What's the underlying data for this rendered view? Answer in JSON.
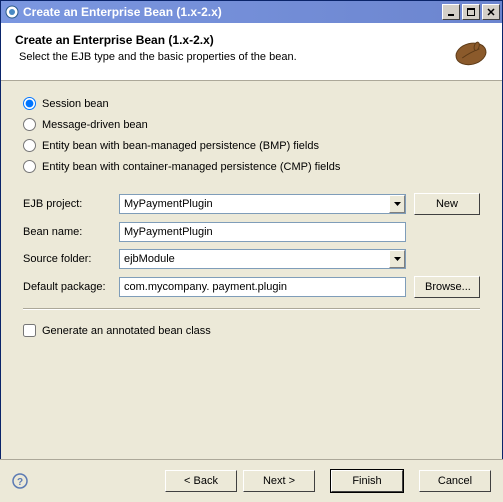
{
  "window": {
    "title": "Create an Enterprise Bean (1.x-2.x)"
  },
  "banner": {
    "title": "Create an Enterprise Bean (1.x-2.x)",
    "subtitle": "Select the EJB type and the basic properties of the bean."
  },
  "beanTypes": {
    "selected": "session",
    "session": "Session bean",
    "mdb": "Message-driven bean",
    "bmp": "Entity bean with bean-managed persistence (BMP) fields",
    "cmp": "Entity bean with container-managed persistence (CMP) fields"
  },
  "form": {
    "ejbProject": {
      "label": "EJB project:",
      "value": "MyPaymentPlugin",
      "newBtn": "New"
    },
    "beanName": {
      "label": "Bean name:",
      "value": "MyPaymentPlugin"
    },
    "sourceFolder": {
      "label": "Source folder:",
      "value": "ejbModule"
    },
    "defaultPackage": {
      "label": "Default package:",
      "value": "com.mycompany. payment.plugin",
      "browseBtn": "Browse..."
    }
  },
  "options": {
    "generateAnnotated": {
      "label": "Generate an annotated bean class",
      "checked": false
    }
  },
  "footer": {
    "back": "< Back",
    "next": "Next >",
    "finish": "Finish",
    "cancel": "Cancel"
  }
}
